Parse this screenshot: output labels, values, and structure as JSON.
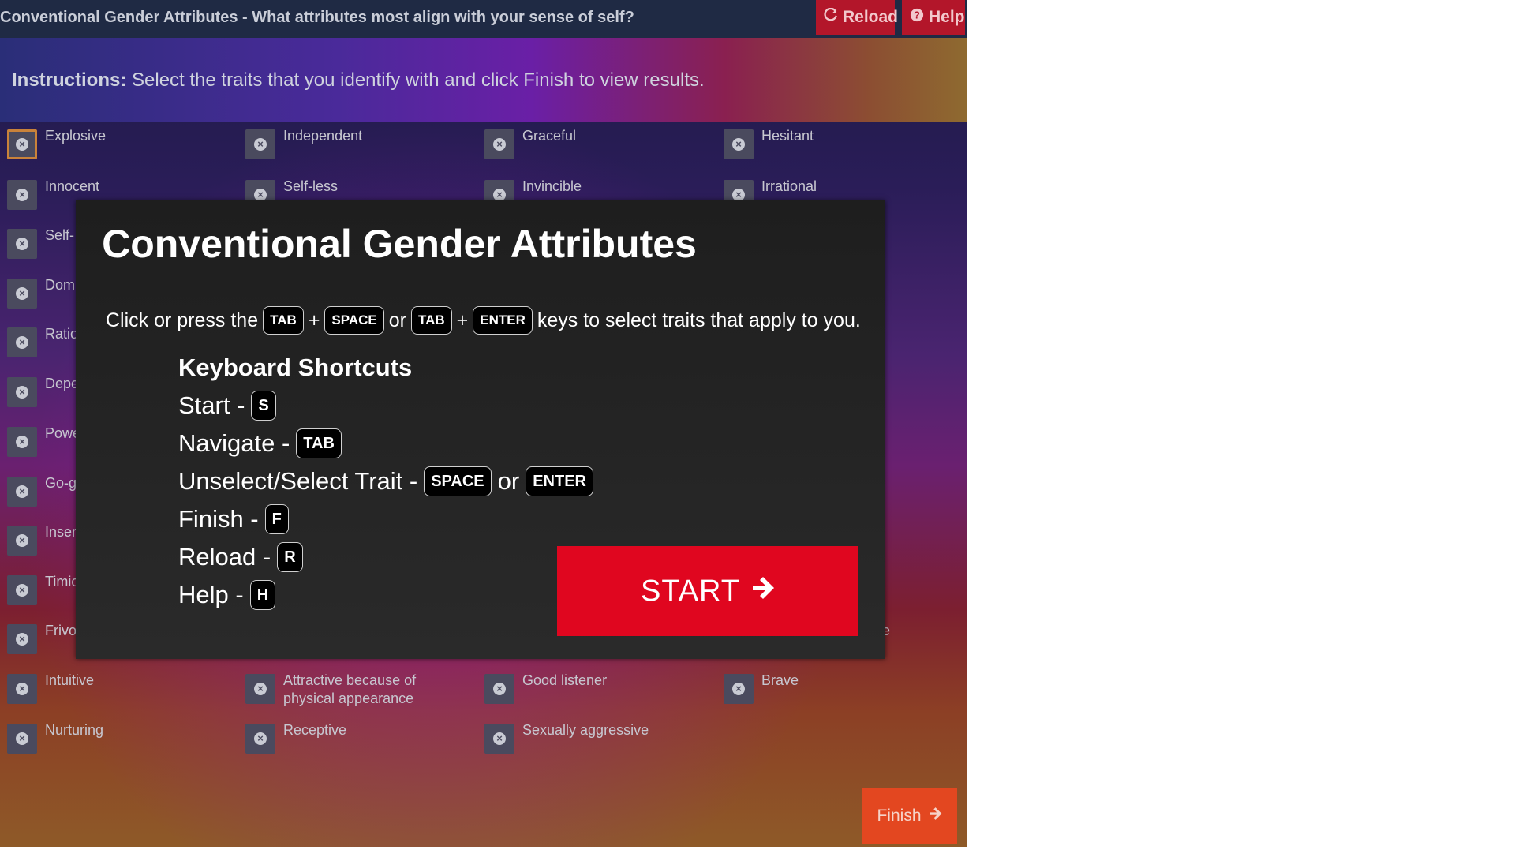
{
  "header": {
    "title": "Conventional Gender Attributes - What attributes most align with your sense of self?",
    "reload_label": "Reload",
    "help_label": "Help",
    "reload_icon": "refresh-icon",
    "help_icon": "question-circle-icon"
  },
  "instructions": {
    "label": "Instructions:",
    "text": "Select the traits that you identify with and click Finish to view results."
  },
  "traits": [
    {
      "label": "Explosive"
    },
    {
      "label": "Independent"
    },
    {
      "label": "Graceful"
    },
    {
      "label": "Hesitant"
    },
    {
      "label": "Innocent"
    },
    {
      "label": "Self-less"
    },
    {
      "label": "Invincible"
    },
    {
      "label": "Irrational"
    },
    {
      "label": "Self-"
    },
    {
      "label": "Domi"
    },
    {
      "label": "Ratio"
    },
    {
      "label": "Depe"
    },
    {
      "label": "Powe"
    },
    {
      "label": "Go-g"
    },
    {
      "label": "Inser"
    },
    {
      "label": "Timic"
    },
    {
      "label": "Frivo"
    },
    {
      "label": "e"
    },
    {
      "label": "Intuitive"
    },
    {
      "label": "Attractive because of physical appearance"
    },
    {
      "label": "Good listener"
    },
    {
      "label": "Brave"
    },
    {
      "label": "Nurturing"
    },
    {
      "label": "Receptive"
    },
    {
      "label": "Sexually aggressive"
    }
  ],
  "modal": {
    "title": "Conventional Gender Attributes",
    "line_prefix": "Click or press the",
    "key_tab": "TAB",
    "plus": "+",
    "key_space": "SPACE",
    "or": "or",
    "key_enter": "ENTER",
    "line_suffix": "keys to select traits that apply to you.",
    "shortcuts_title": "Keyboard Shortcuts",
    "shortcuts": [
      {
        "label": "Start -",
        "key": "S"
      },
      {
        "label": "Navigate -",
        "key": "TAB"
      },
      {
        "label": "Unselect/Select Trait -",
        "key": "SPACE",
        "or": "or",
        "key2": "ENTER"
      },
      {
        "label": "Finish -",
        "key": "F"
      },
      {
        "label": "Reload -",
        "key": "R"
      },
      {
        "label": "Help -",
        "key": "H"
      }
    ],
    "start_label": "START",
    "start_icon": "arrow-right-icon"
  },
  "finish": {
    "label": "Finish",
    "icon": "arrow-right-icon"
  }
}
